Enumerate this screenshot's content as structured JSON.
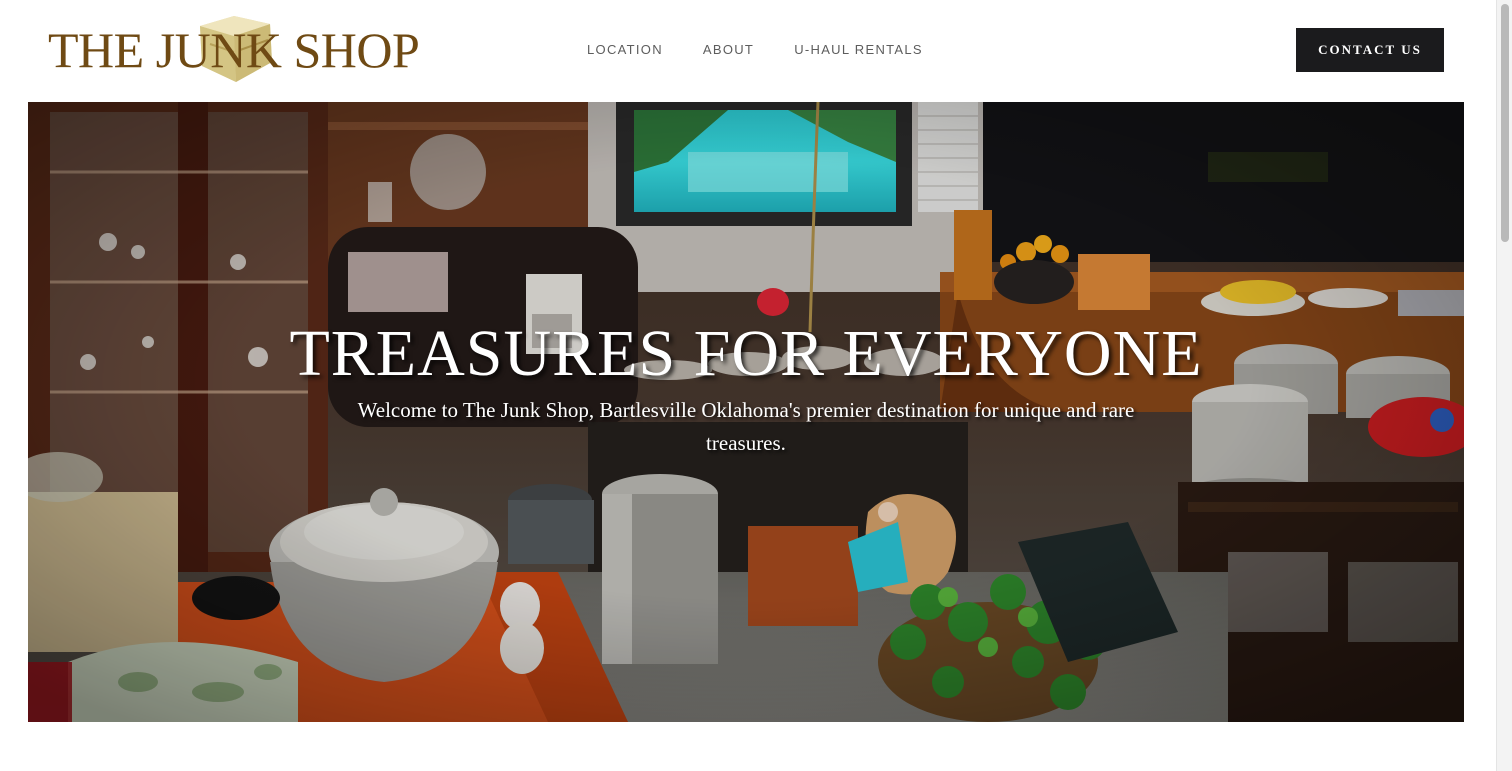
{
  "header": {
    "logo_text": "THE JUNK SHOP",
    "nav": [
      {
        "label": "LOCATION"
      },
      {
        "label": "ABOUT"
      },
      {
        "label": "U-HAUL RENTALS"
      }
    ],
    "contact_label": "CONTACT US"
  },
  "hero": {
    "title": "TREASURES FOR EVERYONE",
    "subtitle": "Welcome to The Junk Shop, Bartlesville Oklahoma's premier destination for unique and rare treasures."
  },
  "colors": {
    "logo": "#6f4a14",
    "logo_mark": "#d8c98c",
    "button_bg": "#1b1b1d",
    "nav_text": "#5d5d5d"
  },
  "icons": [
    "logo-crate-icon"
  ]
}
